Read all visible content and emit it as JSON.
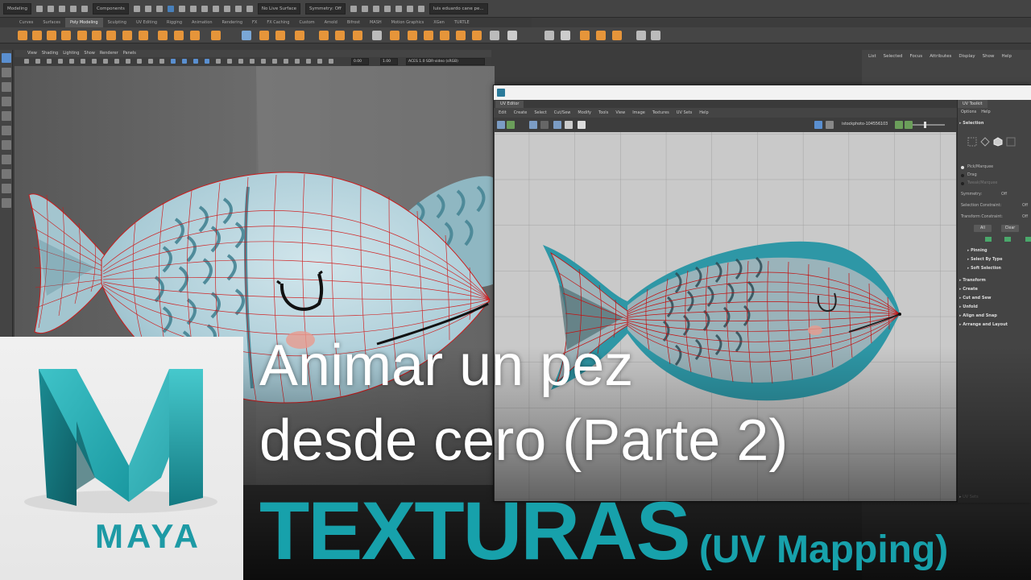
{
  "menubar": {
    "mode_dropdown": "Modeling",
    "components_dropdown": "Components",
    "live_surface": "No Live Surface",
    "symmetry": "Symmetry: Off",
    "user": "luis eduardo cane pe..."
  },
  "shelf": {
    "tabs": [
      "Curves",
      "Surfaces",
      "Poly Modeling",
      "Sculpting",
      "UV Editing",
      "Rigging",
      "Animation",
      "Rendering",
      "FX",
      "FX Caching",
      "Custom",
      "Arnold",
      "Bifrost",
      "MASH",
      "Motion Graphics",
      "XGen",
      "TURTLE"
    ],
    "active_tab": "Poly Modeling"
  },
  "viewport": {
    "menu": [
      "View",
      "Shading",
      "Lighting",
      "Show",
      "Renderer",
      "Panels"
    ],
    "field_a": "0.00",
    "field_b": "1.00",
    "color_space": "ACES 1.0 SDR-video (sRGB)"
  },
  "right_panel": {
    "menu": [
      "List",
      "Selected",
      "Focus",
      "Attributes",
      "Display",
      "Show",
      "Help"
    ]
  },
  "uv_editor": {
    "tab": "UV Editor",
    "menu": [
      "Edit",
      "Create",
      "Select",
      "Cut/Sew",
      "Modify",
      "Tools",
      "View",
      "Image",
      "Textures",
      "UV Sets",
      "Help"
    ],
    "image_name": "istockphoto-104556103"
  },
  "uv_toolkit": {
    "tab": "UV Toolkit",
    "menu": [
      "Options",
      "Help"
    ],
    "selection_header": "Selection",
    "modes": [
      "Pick/Marquee",
      "Drag",
      "Tweak/Marquee"
    ],
    "symmetry_label": "Symmetry:",
    "symmetry_value": "Off",
    "selection_constraint_label": "Selection Constraint:",
    "selection_constraint_value": "Off",
    "transform_constraint_label": "Transform Constraint:",
    "transform_constraint_value": "Off",
    "all_button": "All",
    "clear_button": "Clear",
    "subsections": [
      "Pinning",
      "Select By Type",
      "Soft Selection"
    ],
    "sections": [
      "Transform",
      "Create",
      "Cut and Sew",
      "Unfold",
      "Align and Snap",
      "Arrange and Layout"
    ],
    "uv_sets": "UV Sets"
  },
  "overlay": {
    "logo_text": "MAYA",
    "title_line1": "Animar un pez",
    "title_line2": "desde cero (Parte 2)",
    "title_main": "TEXTURAS",
    "title_sub": "(UV Mapping)"
  },
  "colors": {
    "accent_teal": "#17a1ab",
    "fish_body": "#a9cbd6",
    "fish_pattern": "#3e7f8f",
    "wire": "#e01010"
  }
}
